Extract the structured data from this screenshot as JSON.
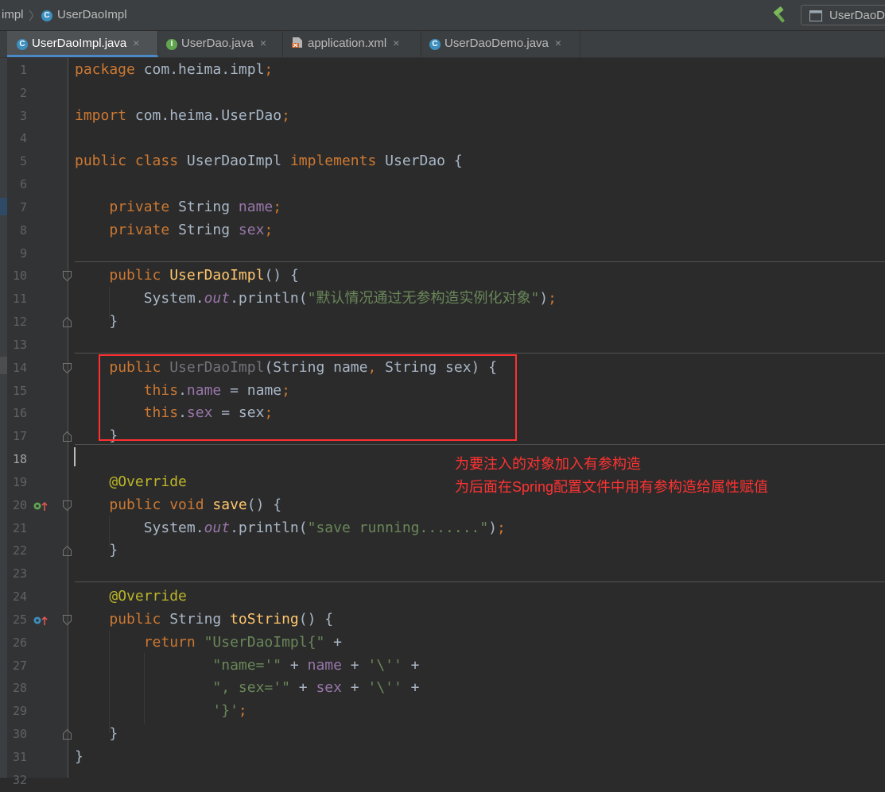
{
  "navbar": {
    "breadcrumb_package": "impl",
    "breadcrumb_separator": "〉",
    "breadcrumb_class": "UserDaoImpl",
    "run_config": "UserDaoDemo"
  },
  "tabs": [
    {
      "label": "UserDaoImpl.java",
      "icon": "class-icon",
      "active": true
    },
    {
      "label": "UserDao.java",
      "icon": "interface-icon",
      "active": false
    },
    {
      "label": "application.xml",
      "icon": "xml-file-icon",
      "active": false
    },
    {
      "label": "UserDaoDemo.java",
      "icon": "class-icon",
      "active": false
    }
  ],
  "tab_close_glyph": "×",
  "line_numbers": [
    "1",
    "2",
    "3",
    "4",
    "5",
    "6",
    "7",
    "8",
    "9",
    "10",
    "11",
    "12",
    "13",
    "14",
    "15",
    "16",
    "17",
    "18",
    "19",
    "20",
    "21",
    "22",
    "23",
    "24",
    "25",
    "26",
    "27",
    "28",
    "29",
    "30",
    "31",
    "32"
  ],
  "current_line": 18,
  "code": [
    [
      [
        "kw",
        "package "
      ],
      [
        "",
        "com.heima.impl"
      ],
      [
        "kw",
        ";"
      ]
    ],
    [],
    [
      [
        "kw",
        "import "
      ],
      [
        "",
        "com.heima.UserDao"
      ],
      [
        "kw",
        ";"
      ]
    ],
    [],
    [
      [
        "kw",
        "public class "
      ],
      [
        "",
        "UserDaoImpl "
      ],
      [
        "kw",
        "implements "
      ],
      [
        "",
        "UserDao {"
      ]
    ],
    [],
    [
      [
        "",
        "    "
      ],
      [
        "kw",
        "private "
      ],
      [
        "",
        "String "
      ],
      [
        "fld",
        "name"
      ],
      [
        "kw",
        ";"
      ]
    ],
    [
      [
        "",
        "    "
      ],
      [
        "kw",
        "private "
      ],
      [
        "",
        "String "
      ],
      [
        "fld",
        "sex"
      ],
      [
        "kw",
        ";"
      ]
    ],
    [],
    [
      [
        "",
        "    "
      ],
      [
        "kw",
        "public "
      ],
      [
        "fn",
        "UserDaoImpl"
      ],
      [
        "",
        "() {"
      ]
    ],
    [
      [
        "",
        "        System."
      ],
      [
        "sfld",
        "out"
      ],
      [
        "",
        ".println("
      ],
      [
        "str",
        "\"默认情况通过无参构造实例化对象\""
      ],
      [
        "",
        ")"
      ],
      [
        "kw",
        ";"
      ]
    ],
    [
      [
        "",
        "    }"
      ]
    ],
    [],
    [
      [
        "",
        "    "
      ],
      [
        "kw",
        "public "
      ],
      [
        "unused",
        "UserDaoImpl"
      ],
      [
        "",
        "(String name"
      ],
      [
        "kw",
        ", "
      ],
      [
        "",
        "String sex) {"
      ]
    ],
    [
      [
        "",
        "        "
      ],
      [
        "kw",
        "this"
      ],
      [
        "",
        "."
      ],
      [
        "fld",
        "name"
      ],
      [
        "",
        " = name"
      ],
      [
        "kw",
        ";"
      ]
    ],
    [
      [
        "",
        "        "
      ],
      [
        "kw",
        "this"
      ],
      [
        "",
        "."
      ],
      [
        "fld",
        "sex"
      ],
      [
        "",
        " = sex"
      ],
      [
        "kw",
        ";"
      ]
    ],
    [
      [
        "",
        "    }"
      ]
    ],
    [],
    [
      [
        "",
        "    "
      ],
      [
        "ann",
        "@Override"
      ]
    ],
    [
      [
        "",
        "    "
      ],
      [
        "kw",
        "public void "
      ],
      [
        "fn",
        "save"
      ],
      [
        "",
        "() {"
      ]
    ],
    [
      [
        "",
        "        System."
      ],
      [
        "sfld",
        "out"
      ],
      [
        "",
        ".println("
      ],
      [
        "str",
        "\"save running.......\""
      ],
      [
        "",
        ")"
      ],
      [
        "kw",
        ";"
      ]
    ],
    [
      [
        "",
        "    }"
      ]
    ],
    [],
    [
      [
        "",
        "    "
      ],
      [
        "ann",
        "@Override"
      ]
    ],
    [
      [
        "",
        "    "
      ],
      [
        "kw",
        "public "
      ],
      [
        "",
        "String "
      ],
      [
        "fn",
        "toString"
      ],
      [
        "",
        "() {"
      ]
    ],
    [
      [
        "",
        "        "
      ],
      [
        "kw",
        "return "
      ],
      [
        "str",
        "\"UserDaoImpl{\""
      ],
      [
        "",
        " +"
      ]
    ],
    [
      [
        "",
        "                "
      ],
      [
        "str",
        "\"name='\""
      ],
      [
        "",
        " + "
      ],
      [
        "fld",
        "name"
      ],
      [
        "",
        " + "
      ],
      [
        "str",
        "'\\''"
      ],
      [
        "",
        " +"
      ]
    ],
    [
      [
        "",
        "                "
      ],
      [
        "str",
        "\", sex='\""
      ],
      [
        "",
        " + "
      ],
      [
        "fld",
        "sex"
      ],
      [
        "",
        " + "
      ],
      [
        "str",
        "'\\''"
      ],
      [
        "",
        " +"
      ]
    ],
    [
      [
        "",
        "                "
      ],
      [
        "str",
        "'}'"
      ],
      [
        "kw",
        ";"
      ]
    ],
    [
      [
        "",
        "    }"
      ]
    ],
    [
      [
        "",
        "}"
      ]
    ],
    []
  ],
  "annotation_lines": [
    "为要注入的对象加入有参构造",
    "为后面在Spring配置文件中用有参构造给属性赋值"
  ],
  "colors": {
    "background": "#2b2b2b",
    "keyword": "#cc7832",
    "field": "#9876aa",
    "method": "#ffc66d",
    "string": "#6a8759",
    "annotation": "#bbb529",
    "highlight_box": "#ff3030",
    "annotation_text": "#ff3232"
  }
}
